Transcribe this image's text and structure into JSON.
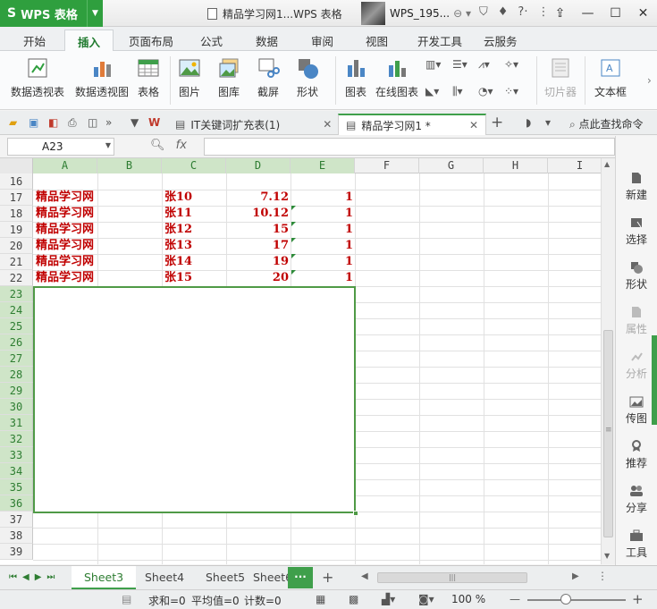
{
  "app": {
    "name": "WPS 表格",
    "window_title": "精品学习网1...WPS 表格",
    "user": "WPS_195..."
  },
  "menu_tabs": [
    "开始",
    "插入",
    "页面布局",
    "公式",
    "数据",
    "审阅",
    "视图",
    "开发工具",
    "云服务"
  ],
  "active_menu_tab": "插入",
  "ribbon": {
    "pivot_table": "数据透视表",
    "pivot_chart": "数据透视图",
    "table": "表格",
    "picture": "图片",
    "gallery": "图库",
    "screenshot": "截屏",
    "shapes": "形状",
    "chart": "图表",
    "online_chart": "在线图表",
    "slicer": "切片器",
    "textbox": "文本框"
  },
  "doc_tabs": [
    {
      "label": "IT关键词扩充表(1)",
      "active": false
    },
    {
      "label": "精品学习网1 *",
      "active": true
    }
  ],
  "find_command": "点此查找命令",
  "formula_bar": {
    "name_box": "A23",
    "fx": "fx",
    "formula": ""
  },
  "columns": [
    "A",
    "B",
    "C",
    "D",
    "E",
    "F",
    "G",
    "H",
    "I"
  ],
  "rows": [
    "16",
    "17",
    "18",
    "19",
    "20",
    "21",
    "22",
    "23",
    "24",
    "25",
    "26",
    "27",
    "28",
    "29",
    "30",
    "31",
    "32",
    "33",
    "34",
    "35",
    "36",
    "37",
    "38",
    "39"
  ],
  "data_rows": [
    {
      "row": "17",
      "a": "精品学习网",
      "c": "张10",
      "d": "7.12",
      "e": "1"
    },
    {
      "row": "18",
      "a": "精品学习网",
      "c": "张11",
      "d": "10.12",
      "e": "1"
    },
    {
      "row": "19",
      "a": "精品学习网",
      "c": "张12",
      "d": "15",
      "e": "1"
    },
    {
      "row": "20",
      "a": "精品学习网",
      "c": "张13",
      "d": "17",
      "e": "1"
    },
    {
      "row": "21",
      "a": "精品学习网",
      "c": "张14",
      "d": "19",
      "e": "1"
    },
    {
      "row": "22",
      "a": "精品学习网",
      "c": "张15",
      "d": "20",
      "e": "1"
    }
  ],
  "right_pane": [
    "新建",
    "选择",
    "形状",
    "属性",
    "分析",
    "传图",
    "推荐",
    "分享",
    "工具"
  ],
  "sheet_tabs": [
    "Sheet3",
    "Sheet4",
    "Sheet5",
    "Sheet6"
  ],
  "active_sheet": "Sheet3",
  "status": {
    "sum": "求和=0",
    "avg": "平均值=0",
    "count": "计数=0",
    "zoom": "100 %"
  },
  "colors": {
    "accent": "#3f9f4b",
    "cell_text": "#c00000"
  }
}
